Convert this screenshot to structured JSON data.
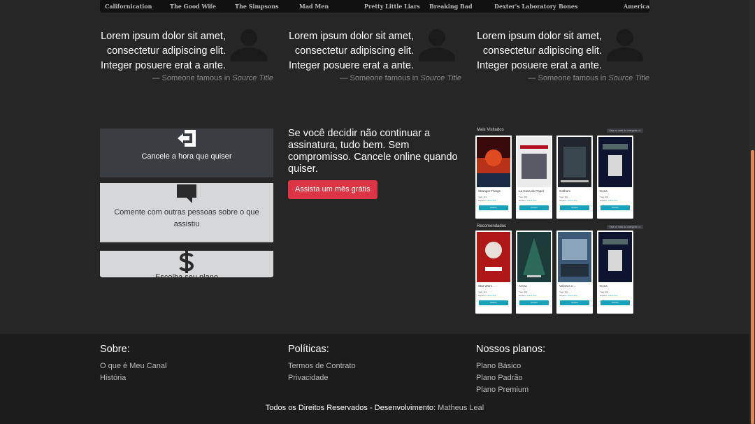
{
  "shows": [
    "Californication",
    "The Good Wife",
    "The Simpsons",
    "Mad Men",
    "Pretty Little Liars",
    "Breaking Bad",
    "Dexter's Laboratory",
    "Bones",
    "American"
  ],
  "testimonials": [
    {
      "text": "Lorem ipsum dolor sit amet, consectetur adipiscing elit. Integer posuere erat a ante.",
      "dash": "— ",
      "author": "Someone famous",
      "in": " in ",
      "source": "Source Title"
    },
    {
      "text": "Lorem ipsum dolor sit amet, consectetur adipiscing elit. Integer posuere erat a ante.",
      "dash": "— ",
      "author": "Someone famous",
      "in": " in ",
      "source": "Source Title"
    },
    {
      "text": "Lorem ipsum dolor sit amet, consectetur adipiscing elit. Integer posuere erat a ante.",
      "dash": "— ",
      "author": "Someone famous",
      "in": " in ",
      "source": "Source Title"
    }
  ],
  "features": [
    {
      "label": "Cancele a hora que quiser",
      "icon": "exit-icon"
    },
    {
      "label": "Comente com outras pessoas sobre o que assistiu",
      "icon": "comment-icon"
    },
    {
      "label": "Escolha seu plano",
      "icon": "dollar-icon"
    }
  ],
  "promo": {
    "text": "Se você decidir não continuar a assinatura, tudo bem. Sem compromisso. Cancele online quando quiser.",
    "button": "Assista um mês grátis"
  },
  "preview": {
    "most_watched": "Mais Visitados",
    "recommended": "Recomendados",
    "see_more": "Veja os mais da categoria >>",
    "year_label": "Year: ",
    "genre_label": "Gênero: ",
    "genre_value": "Crime Asp",
    "card_button": "Assistir",
    "row1": [
      {
        "title": "Stranger Things",
        "year": "3rd"
      },
      {
        "title": "La Casa de Papel",
        "year": "3rd"
      },
      {
        "title": "Gotham",
        "year": "3rd"
      },
      {
        "title": "Cona",
        "year": "3rd"
      }
    ],
    "row2": [
      {
        "title": "Star Wars ...",
        "year": "3rd"
      },
      {
        "title": "Arrow",
        "year": "3rd"
      },
      {
        "title": "Velozes e ...",
        "year": "3rd"
      },
      {
        "title": "Cona",
        "year": "3rd"
      }
    ]
  },
  "footer": {
    "col1": {
      "title": "Sobre:",
      "links": [
        "O que é Meu Canal",
        "História"
      ]
    },
    "col2": {
      "title": "Políticas:",
      "links": [
        "Termos de Contrato",
        "Privacidade"
      ]
    },
    "col3": {
      "title": "Nossos planos:",
      "links": [
        "Plano Básico",
        "Plano Padrão",
        "Plano Premium"
      ]
    },
    "copyright": "Todos os Direitos Reservados - Desenvolvimento: ",
    "author": "Matheus Leal"
  },
  "colors": {
    "accent_red": "#dc3545",
    "accent_teal": "#17a2b8",
    "footer_bg": "#1c1c1c",
    "page_bg": "#262626"
  }
}
